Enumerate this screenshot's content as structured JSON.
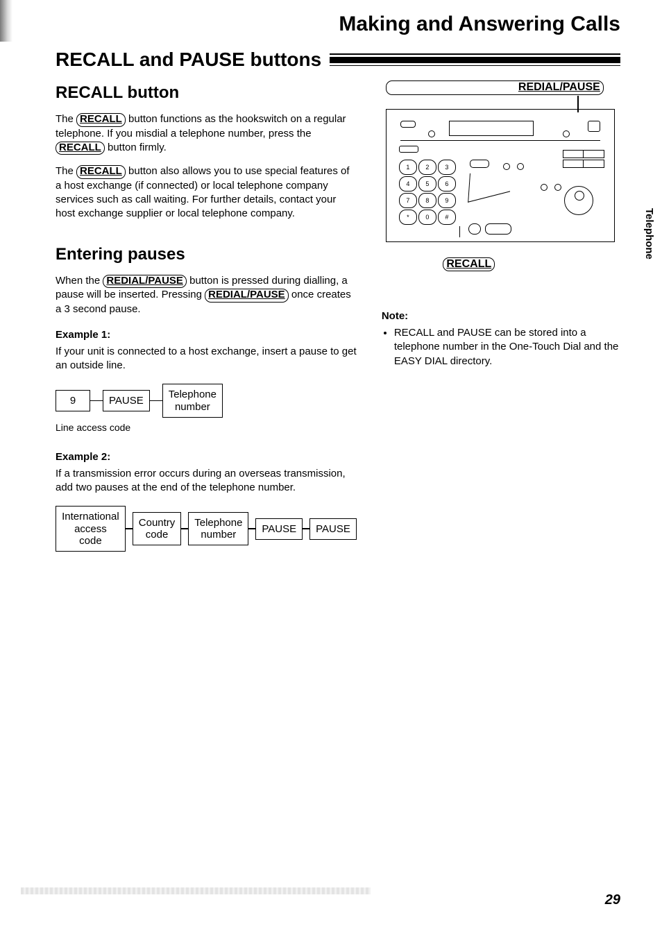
{
  "chapter_title": "Making and Answering Calls",
  "section_title": "RECALL and PAUSE buttons",
  "side_tab": "Telephone",
  "page_number": "29",
  "recall": {
    "heading": "RECALL button",
    "btn": "RECALL",
    "p1a": "The ",
    "p1b": " button functions as the hookswitch on a regular telephone. If you misdial a telephone number, press the ",
    "p1c": " button firmly.",
    "p2a": "The ",
    "p2b": " button also allows you to use special features of a host exchange (if connected) or local telephone company services such as call waiting. For further details, contact your host exchange supplier or local telephone company."
  },
  "pauses": {
    "heading": "Entering pauses",
    "btn": "REDIAL/PAUSE",
    "p1a": "When the ",
    "p1b": " button is pressed during dialling, a pause will be inserted. Pressing ",
    "p1c": " once creates a 3 second pause."
  },
  "example1": {
    "header": "Example 1:",
    "text": "If your unit is connected to a host exchange, insert a pause to get an outside line.",
    "box1": "9",
    "box2": "PAUSE",
    "box3": "Telephone\nnumber",
    "caption": "Line access code"
  },
  "example2": {
    "header": "Example 2:",
    "text": "If a transmission error occurs during an overseas transmission, add two pauses at the end of the telephone number.",
    "box1": "International\naccess code",
    "box2": "Country\ncode",
    "box3": "Telephone\nnumber",
    "box4": "PAUSE",
    "box5": "PAUSE"
  },
  "diagram": {
    "top_label": "REDIAL/PAUSE",
    "bottom_label": "RECALL",
    "keys": [
      "1",
      "2",
      "3",
      "4",
      "5",
      "6",
      "7",
      "8",
      "9",
      "*",
      "0",
      "#"
    ]
  },
  "note": {
    "header": "Note:",
    "item": "RECALL and PAUSE can be stored into a telephone number in the One-Touch Dial and the EASY DIAL directory."
  }
}
